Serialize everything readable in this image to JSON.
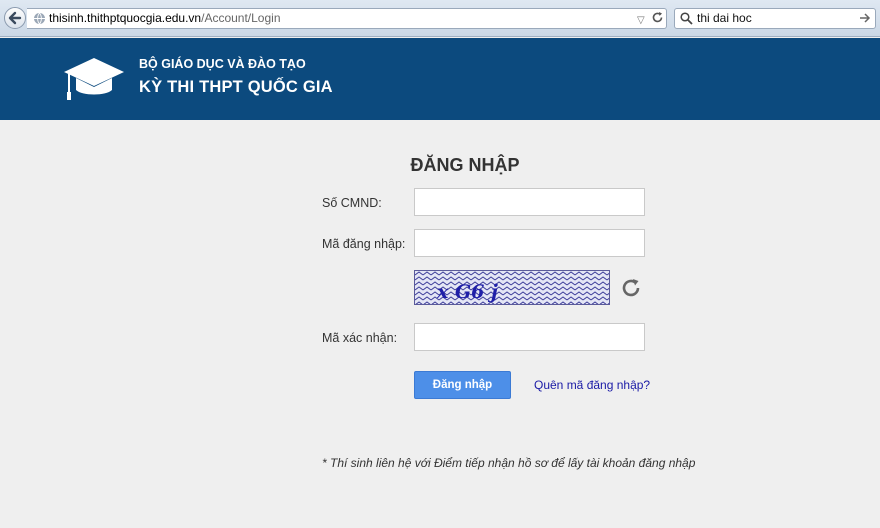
{
  "browser": {
    "url_host": "thisinh.thithptquocgia.edu.vn",
    "url_path": "/Account/Login",
    "search_query": "thi dai hoc"
  },
  "header": {
    "org_name": "BỘ GIÁO DỤC VÀ ĐÀO TẠO",
    "exam_name": "KỲ THI THPT QUỐC GIA"
  },
  "login": {
    "title": "ĐĂNG NHẬP",
    "cmnd_label": "Số CMND:",
    "code_label": "Mã đăng nhập:",
    "captcha_label": "Mã xác nhận:",
    "captcha_text": "x G6 j",
    "submit_label": "Đăng nhập",
    "forgot_label": "Quên mã đăng nhập?",
    "note": "* Thí sinh liên hệ với Điểm tiếp nhận hồ sơ để lấy tài khoản đăng nhập"
  },
  "colors": {
    "header_bg": "#0c4a7e",
    "button_bg": "#4d8fe8",
    "link": "#1a1aa6",
    "page_bg": "#efefef"
  }
}
